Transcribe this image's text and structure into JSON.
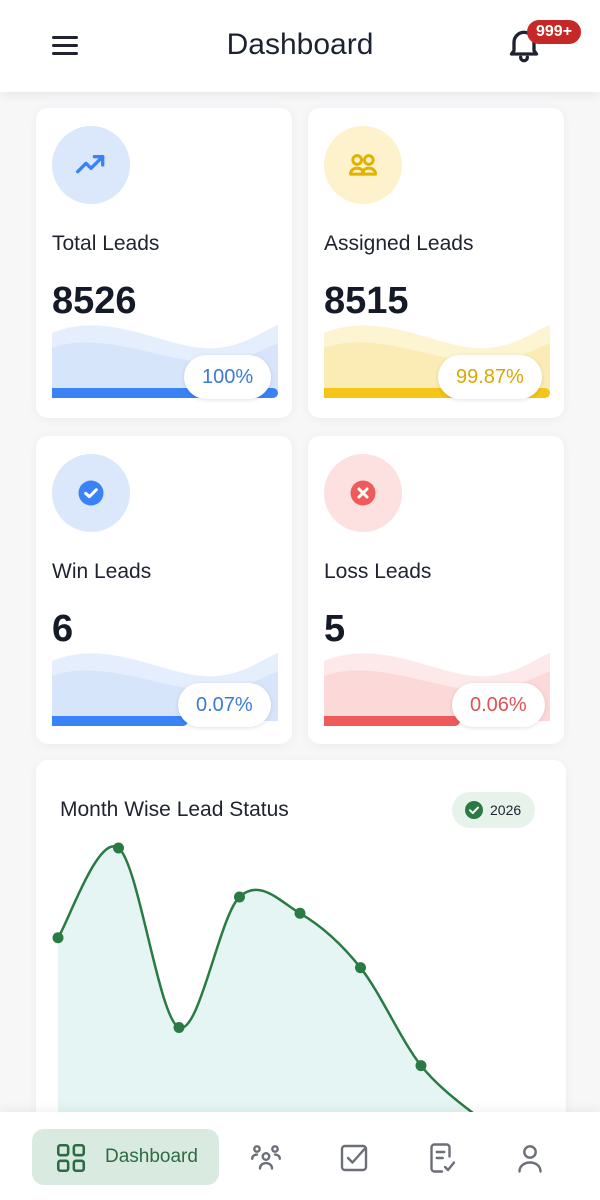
{
  "header": {
    "title": "Dashboard",
    "notification_badge": "999+"
  },
  "cards": [
    {
      "label": "Total Leads",
      "value": "8526",
      "percent": "100%",
      "progress": 1.0,
      "accent": "#3b82f6",
      "icon": "trending-up-icon"
    },
    {
      "label": "Assigned Leads",
      "value": "8515",
      "percent": "99.87%",
      "progress": 0.9987,
      "accent": "#f5c518",
      "icon": "users-icon"
    },
    {
      "label": "Win Leads",
      "value": "6",
      "percent": "0.07%",
      "progress": 0.0007,
      "accent": "#3b82f6",
      "icon": "check-circle-icon"
    },
    {
      "label": "Loss Leads",
      "value": "5",
      "percent": "0.06%",
      "progress": 0.0006,
      "accent": "#ef5b5b",
      "icon": "x-circle-icon"
    }
  ],
  "month_chart": {
    "title": "Month Wise Lead Status",
    "year": "2026"
  },
  "chart_data": {
    "type": "area",
    "title": "Month Wise Lead Status",
    "year_filter": "2026",
    "series": [
      {
        "values": [
          67,
          100,
          34,
          82,
          76,
          56,
          20,
          0
        ]
      }
    ],
    "ylim": [
      0,
      100
    ],
    "grid": false,
    "color": "#2a7a44"
  },
  "bottom_nav": {
    "active_label": "Dashboard",
    "items": [
      "dashboard",
      "team",
      "tasks",
      "reports",
      "profile"
    ]
  }
}
